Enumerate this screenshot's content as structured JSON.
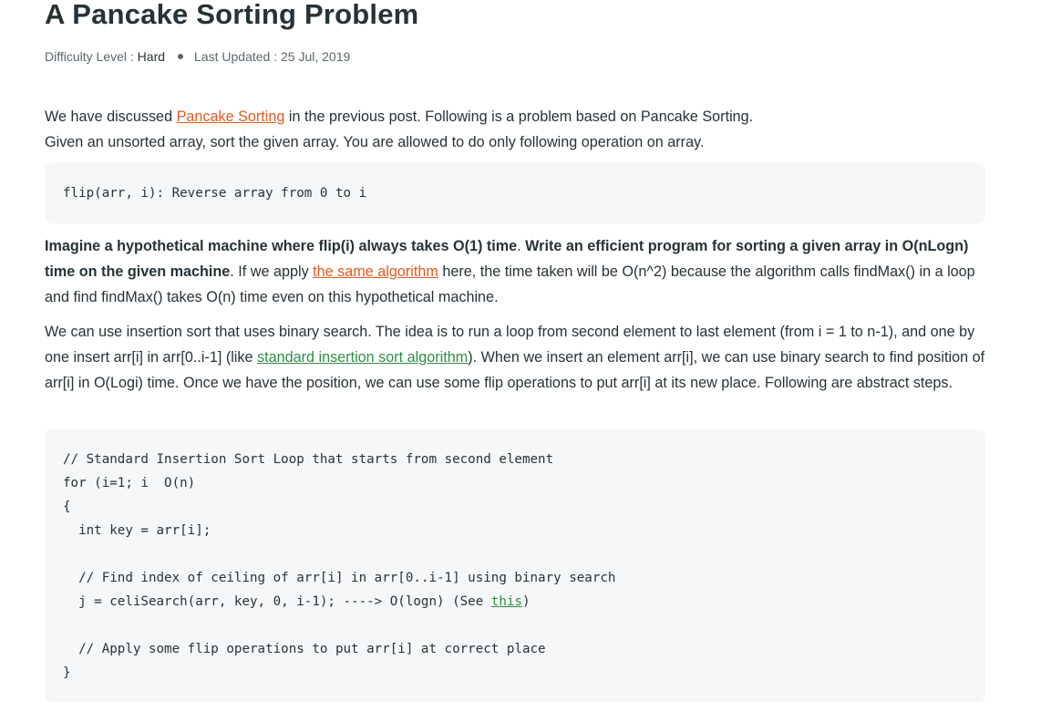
{
  "article": {
    "title": "A Pancake Sorting Problem",
    "meta": {
      "difficulty_label": "Difficulty Level : ",
      "difficulty_value": "Hard",
      "updated": "Last Updated : 25 Jul, 2019"
    },
    "p1": {
      "s1": "We have discussed ",
      "link1": "Pancake Sorting",
      "s2": " in the previous post. Following is a problem based on Pancake Sorting.",
      "s3": "Given an unsorted array, sort the given array. You are allowed to do only following operation on array."
    },
    "code1": {
      "line1": "flip(arr, i): Reverse array from 0 to i"
    },
    "p2": {
      "b1": "Imagine a hypothetical machine where flip(i) always takes O(1) time",
      "s1": ". ",
      "b2": "Write an efficient program for sorting a given array in O(nLogn) time on the given machine",
      "s2": ". If we apply ",
      "link1": "the same algorithm",
      "s3": " here, the time taken will be O(n^2) because the algorithm calls findMax() in a loop and find findMax() takes O(n) time even on this hypothetical machine."
    },
    "p3": {
      "s1": "We can use insertion sort that uses binary search. The idea is to run a loop from second element to last element (from i = 1 to n-1), and one by one insert arr[i] in arr[0..i-1] (like ",
      "link1": "standard insertion sort algorithm",
      "s2": "). When we insert an element arr[i], we can use binary search to find position of arr[i] in O(Logi) time. Once we have the position, we can use some flip operations to put arr[i] at its new place. Following are abstract steps."
    },
    "code2": {
      "line1": "// Standard Insertion Sort Loop that starts from second element",
      "line2": "for (i=1; i  O(n)",
      "line3": "{",
      "line4": "  int key = arr[i];",
      "line5": "  // Find index of ceiling of arr[i] in arr[0..i-1] using binary search",
      "line6a": "  j = celiSearch(arr, key, 0, i-1); ----> O(logn) (See ",
      "line6link": "this",
      "line6b": ")",
      "line7": "  // Apply some flip operations to put arr[i] at correct place",
      "line8": "}"
    }
  },
  "colors": {
    "text": "#273239",
    "link_orange": "#e05a1f",
    "link_green": "#2f8d46",
    "code_bg": "#f6f7f8"
  }
}
